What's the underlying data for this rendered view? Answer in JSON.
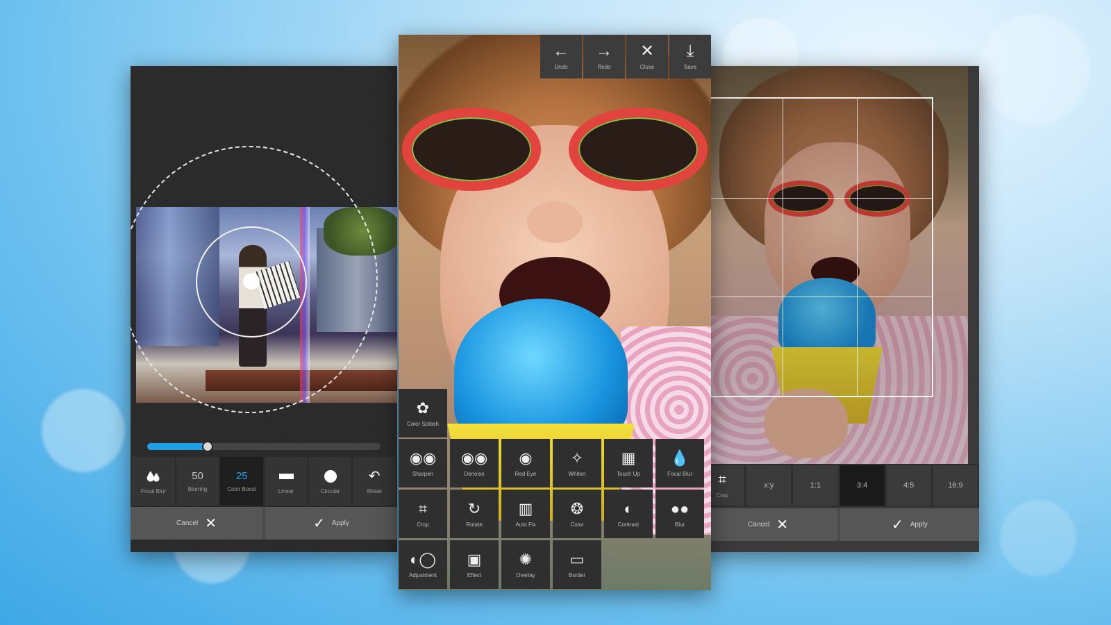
{
  "left_panel": {
    "slider": {
      "value_fraction": 0.26
    },
    "tools": [
      {
        "label": "Focal Blur",
        "icon": "drop-icon"
      },
      {
        "value": "50",
        "label": "Blurring"
      },
      {
        "value": "25",
        "label": "Color Boost"
      },
      {
        "label": "Linear",
        "icon": "rectangle-icon"
      },
      {
        "label": "Circular",
        "icon": "circle-icon"
      },
      {
        "label": "Reset",
        "icon": "reset-icon"
      }
    ],
    "cancel_label": "Cancel",
    "apply_label": "Apply"
  },
  "center_panel": {
    "topbar": [
      {
        "label": "Undo",
        "icon": "←"
      },
      {
        "label": "Redo",
        "icon": "→"
      },
      {
        "label": "Close",
        "icon": "✕"
      },
      {
        "label": "Save",
        "icon": "⤓"
      }
    ],
    "color_splash": {
      "label": "Color Splash",
      "icon": "✿"
    },
    "tools_row1": [
      {
        "label": "Sharpen",
        "icon": "◉◉"
      },
      {
        "label": "Denoise",
        "icon": "◉◉"
      },
      {
        "label": "Red Eye",
        "icon": "◉"
      },
      {
        "label": "Whiten",
        "icon": "✧"
      },
      {
        "label": "Touch Up",
        "icon": "▦"
      },
      {
        "label": "Focal Blur",
        "icon": "💧"
      }
    ],
    "tools_row2": [
      {
        "label": "Crop",
        "icon": "⌗"
      },
      {
        "label": "Rotate",
        "icon": "↻"
      },
      {
        "label": "Auto Fix",
        "icon": "▥"
      },
      {
        "label": "Color",
        "icon": "❂"
      },
      {
        "label": "Contrast",
        "icon": "◐"
      },
      {
        "label": "Blur",
        "icon": "●●"
      }
    ],
    "tools_row3": [
      {
        "label": "Adjustment",
        "icon": "◐◯"
      },
      {
        "label": "Effect",
        "icon": "▣"
      },
      {
        "label": "Overlay",
        "icon": "✺"
      },
      {
        "label": "Border",
        "icon": "▭"
      }
    ]
  },
  "right_panel": {
    "ratios": [
      {
        "label": "Crop",
        "icon": "⌗"
      },
      {
        "value": "x:y"
      },
      {
        "value": "1:1"
      },
      {
        "value": "3:4"
      },
      {
        "value": "4:5"
      },
      {
        "value": "16:9"
      }
    ],
    "cancel_label": "Cancel",
    "apply_label": "Apply"
  }
}
